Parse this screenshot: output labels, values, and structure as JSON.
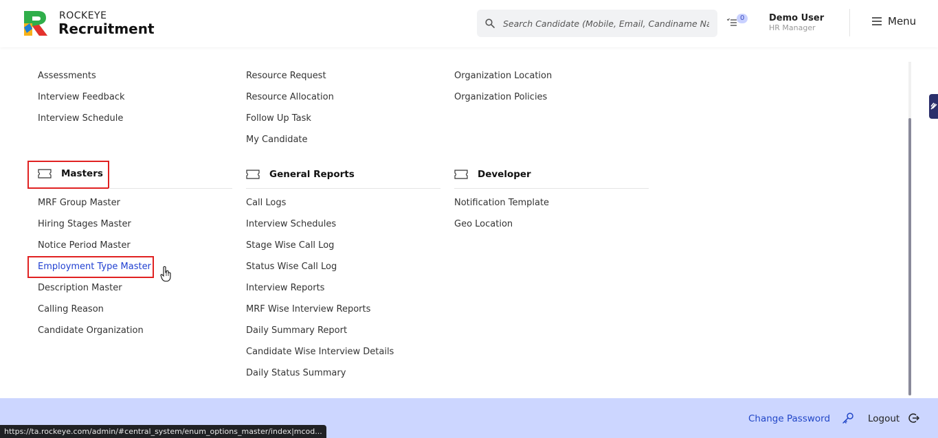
{
  "header": {
    "brand_top": "ROCKEYE",
    "brand_main": "Recruitment",
    "search_placeholder": "Search Candidate (Mobile, Email, Candiname Name)",
    "notification_count": "0",
    "user_name": "Demo User",
    "user_role": "HR Manager",
    "menu_label": "Menu"
  },
  "columns": {
    "col1_top": [
      "Assessments",
      "Interview Feedback",
      "Interview Schedule"
    ],
    "col2_top": [
      "Resource Request",
      "Resource Allocation",
      "Follow Up Task",
      "My Candidate"
    ],
    "col3_top": [
      "Organization Location",
      "Organization Policies"
    ]
  },
  "sections": {
    "masters": {
      "title": "Masters",
      "items": [
        "MRF Group Master",
        "Hiring Stages Master",
        "Notice Period Master",
        "Employment Type Master",
        "Description Master",
        "Calling Reason",
        "Candidate Organization"
      ]
    },
    "general_reports": {
      "title": "General Reports",
      "items": [
        "Call Logs",
        "Interview Schedules",
        "Stage Wise Call Log",
        "Status Wise Call Log",
        "Interview Reports",
        "MRF Wise Interview Reports",
        "Daily Summary Report",
        "Candidate Wise Interview Details",
        "Daily Status Summary"
      ]
    },
    "developer": {
      "title": "Developer",
      "items": [
        "Notification Template",
        "Geo Location"
      ]
    }
  },
  "footer": {
    "change_password": "Change Password",
    "logout": "Logout"
  },
  "status_url": "https://ta.rockeye.com/admin/#central_system/enum_options_master/index|mcod...",
  "colors": {
    "accent_blue": "#1f3fd1",
    "footer_bg": "#ccd6ff",
    "highlight_red": "#e02020"
  }
}
